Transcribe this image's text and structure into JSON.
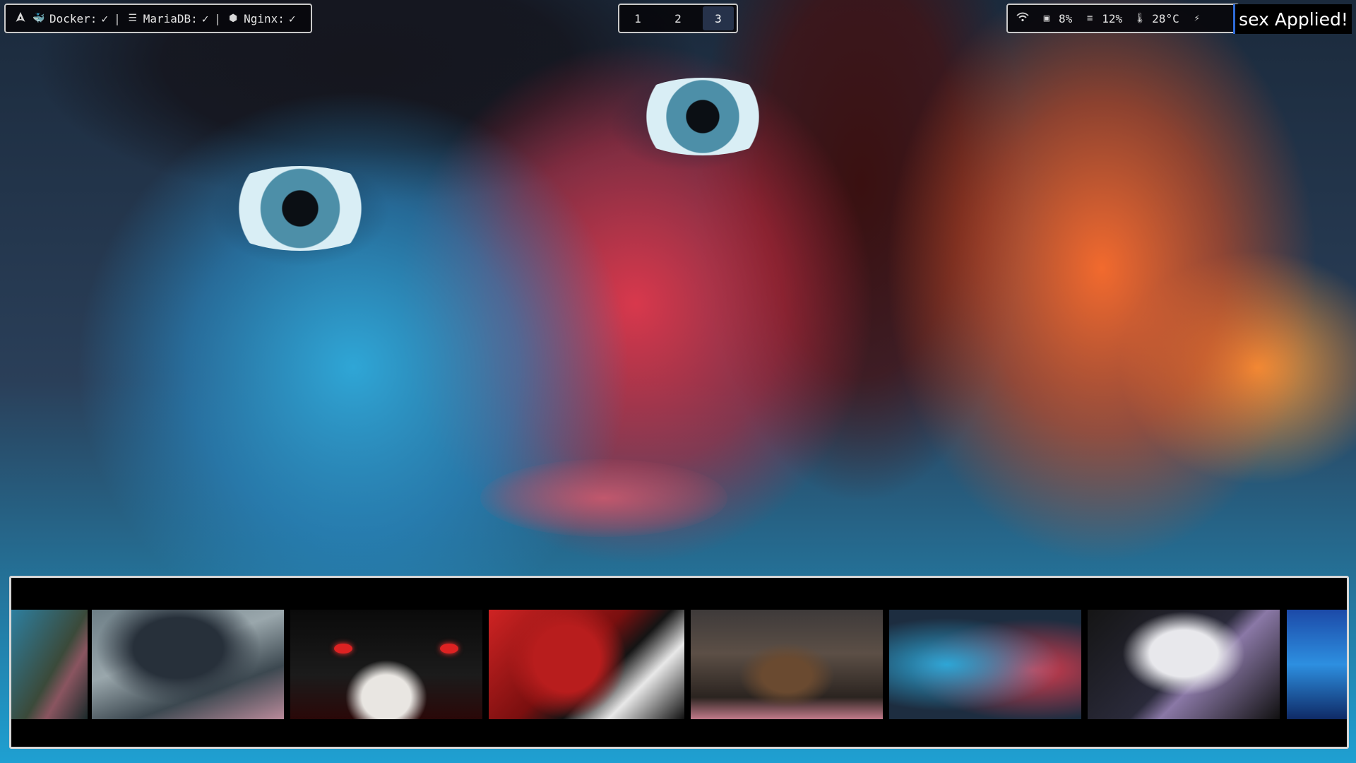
{
  "wallpaper": {
    "description_icon": "wallpaper-background"
  },
  "left_module": {
    "logo_icon": "arch-linux-logo-icon",
    "services": [
      {
        "name": "Docker:",
        "icon": "docker-whale-icon",
        "status": "✓"
      },
      {
        "name": "MariaDB:",
        "icon": "database-icon",
        "status": "✓"
      },
      {
        "name": "Nginx:",
        "icon": "nginx-icon",
        "status": "✓"
      }
    ],
    "separator": "|"
  },
  "workspaces": {
    "items": [
      "1",
      "2",
      "3"
    ],
    "active": "3"
  },
  "right_module": {
    "wifi_icon": "wifi-icon",
    "cpu": {
      "icon": "cpu-icon",
      "value": "8%"
    },
    "memory": {
      "icon": "memory-icon",
      "value": "12%"
    },
    "temperature": {
      "icon": "thermometer-icon",
      "value": "28°C"
    },
    "power_icon": "power-plug-icon"
  },
  "notification": {
    "text": "sex Applied!"
  },
  "wallpaper_selector": {
    "thumbnails": [
      {
        "name": "thumb-anime-girl-shop"
      },
      {
        "name": "thumb-hooded-figure-rain"
      },
      {
        "name": "thumb-dark-red-eyes"
      },
      {
        "name": "thumb-red-mecha"
      },
      {
        "name": "thumb-samurai-temple"
      },
      {
        "name": "thumb-girl-face-neon"
      },
      {
        "name": "thumb-white-hair-anime"
      },
      {
        "name": "thumb-blue-hair"
      }
    ]
  },
  "colors": {
    "bar_background": "#08080c",
    "bar_border": "#c9c9c9",
    "active_workspace": "#26324a",
    "notification_accent": "#2e6bd6"
  }
}
